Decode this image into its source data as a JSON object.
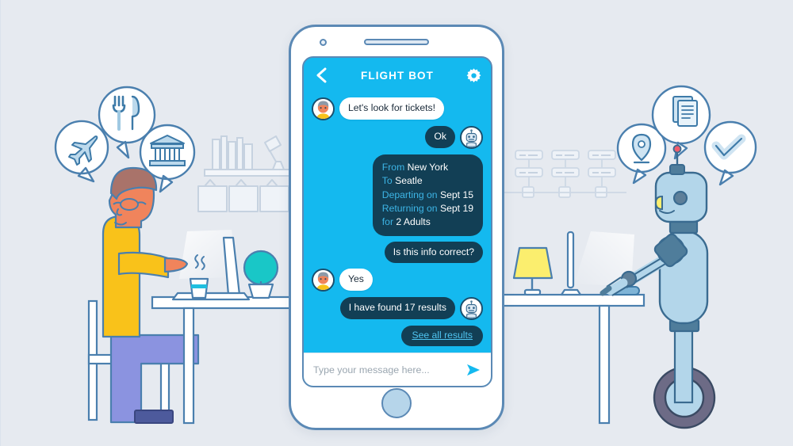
{
  "scene": {
    "background_color": "#e6eaf0",
    "title": "Chatbot travel booking illustration",
    "left_character": "man-at-desk",
    "right_character": "robot-at-desk"
  },
  "phone": {
    "accent_color": "#14b9ef",
    "frame_color": "#5b89b5",
    "bubble_dark_color": "#123f55",
    "speaker_label": "earpiece-speaker",
    "camera_label": "front-camera",
    "home_button_label": "home-button"
  },
  "chat": {
    "header": {
      "title": "FLIGHT BOT",
      "back_icon": "chevron-left-icon",
      "settings_icon": "gear-icon"
    },
    "messages": [
      {
        "id": "msg-1",
        "side": "left",
        "sender": "user",
        "style": "white",
        "text": "Let's look for tickets!",
        "avatar": "user-avatar"
      },
      {
        "id": "msg-2",
        "side": "right",
        "sender": "bot",
        "style": "dark",
        "text": "Ok",
        "avatar": "bot-avatar"
      },
      {
        "id": "msg-3",
        "side": "right",
        "sender": "bot",
        "style": "info",
        "avatar": null,
        "lines": [
          {
            "keyword": "From",
            "value": "New York"
          },
          {
            "keyword": "To",
            "value": "Seatle"
          },
          {
            "keyword": "Departing on",
            "value": "Sept 15"
          },
          {
            "keyword": "Returning on",
            "value": "Sept 19"
          },
          {
            "keyword": "for",
            "value": "2 Adults"
          }
        ]
      },
      {
        "id": "msg-4",
        "side": "right",
        "sender": "bot",
        "style": "dark",
        "text": "Is this info correct?",
        "avatar": null
      },
      {
        "id": "msg-5",
        "side": "left",
        "sender": "user",
        "style": "white",
        "text": "Yes",
        "avatar": "user-avatar"
      },
      {
        "id": "msg-6",
        "side": "right",
        "sender": "bot",
        "style": "dark",
        "text": "I have found 17 results",
        "avatar": "bot-avatar"
      },
      {
        "id": "msg-7",
        "side": "right",
        "sender": "bot",
        "style": "link",
        "text": "See all results",
        "avatar": null
      }
    ],
    "composer": {
      "placeholder": "Type your message here...",
      "value": "",
      "send_icon": "send-paper-plane-icon"
    }
  },
  "left_scene": {
    "thought_bubbles": [
      {
        "icon": "airplane-icon",
        "label": "flight"
      },
      {
        "icon": "fork-knife-icon",
        "label": "restaurant"
      },
      {
        "icon": "museum-icon",
        "label": "museum"
      }
    ],
    "desk_items": [
      {
        "icon": "laptop-icon",
        "label": "laptop"
      },
      {
        "icon": "coffee-cup-icon",
        "label": "hot drink"
      },
      {
        "icon": "potted-plant-icon",
        "label": "plant"
      }
    ],
    "wall_items": [
      {
        "icon": "bookshelf-icon",
        "label": "books on shelf"
      },
      {
        "icon": "desk-lamp-icon",
        "label": "shelf lamp"
      },
      {
        "icon": "picture-frame-icon",
        "label": "hanging frames"
      }
    ]
  },
  "right_scene": {
    "thought_bubbles": [
      {
        "icon": "map-pin-icon",
        "label": "location"
      },
      {
        "icon": "document-icon",
        "label": "document"
      },
      {
        "icon": "check-mark-icon",
        "label": "confirmed"
      }
    ],
    "desk_items": [
      {
        "icon": "monitor-icon",
        "label": "monitor"
      },
      {
        "icon": "table-lamp-icon",
        "label": "lamp"
      },
      {
        "icon": "mouse-icon",
        "label": "mouse"
      }
    ],
    "wall_items": [
      {
        "icon": "server-diagram-icon",
        "label": "network diagram"
      }
    ]
  },
  "colors": {
    "cyan": "#14b9ef",
    "deep_navy": "#123f55",
    "outline_blue": "#4a7fae",
    "shirt_yellow": "#f9c21a",
    "pants_purple": "#8b93e0",
    "skin": "#f0845c",
    "hair": "#a9736a",
    "robot_body": "#b3d6ea",
    "plant_teal": "#19c7c7",
    "lamp_yellow": "#fbee6e"
  }
}
